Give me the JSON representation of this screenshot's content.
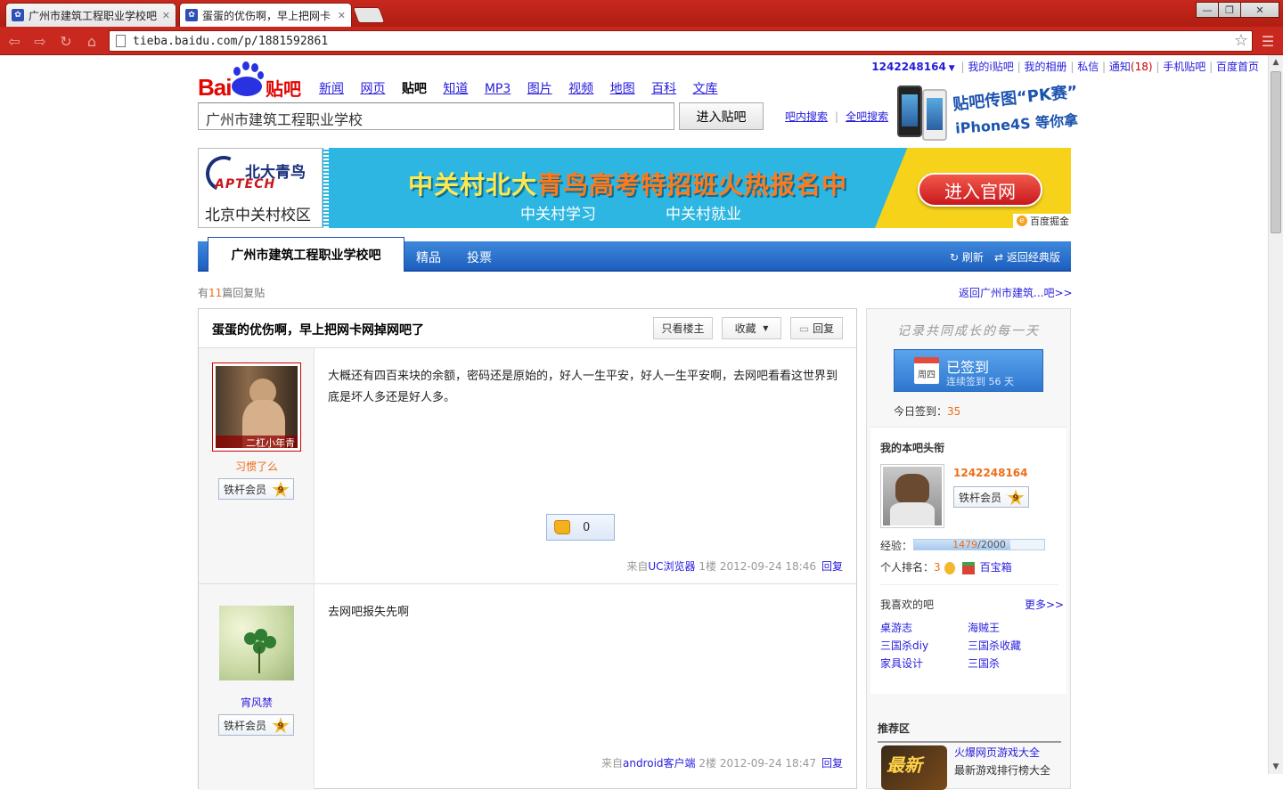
{
  "browser": {
    "tabs": [
      {
        "title": "广州市建筑工程职业学校吧"
      },
      {
        "title": "蛋蛋的优伤啊，早上把网卡"
      }
    ],
    "url": "tieba.baidu.com/p/1881592861"
  },
  "userbar": {
    "uid": "1242248164",
    "links": [
      "我的i贴吧",
      "我的相册",
      "私信"
    ],
    "notice_label": "通知",
    "notice_count": "(18)",
    "links2": [
      "手机贴吧",
      "百度首页"
    ]
  },
  "logo": {
    "bai": "Bai",
    "du": "du",
    "tieba": "贴吧"
  },
  "topnav": {
    "items": [
      "新闻",
      "网页",
      "贴吧",
      "知道",
      "MP3",
      "图片",
      "视频",
      "地图",
      "百科",
      "文库"
    ],
    "active": "贴吧"
  },
  "search": {
    "value": "广州市建筑工程职业学校",
    "button": "进入贴吧",
    "in_forum": "吧内搜索",
    "all_forum": "全吧搜索"
  },
  "promo": {
    "line1": "贴吧传图“PK赛”",
    "line2": "iPhone4S 等你拿"
  },
  "banner": {
    "brand_cn": "北大青鸟",
    "brand_en": "APTECH",
    "campus": "北京中关村校区",
    "headline_a": "中关村北大",
    "headline_b": "青鸟高考特招班火热报名中",
    "sub1": "中关村学习",
    "sub2": "中关村就业",
    "cta": "进入官网",
    "adtag": "百度掘金"
  },
  "forumbar": {
    "tab": "广州市建筑工程职业学校吧",
    "t2": "精品",
    "t3": "投票",
    "refresh": "刷新",
    "classic": "返回经典版"
  },
  "thread_info": {
    "prefix": "有",
    "count": "11",
    "suffix": "篇回复贴",
    "back": "返回广州市建筑...吧>>"
  },
  "thread": {
    "title": "蛋蛋的优伤啊，早上把网卡网掉网吧了",
    "only_author": "只看楼主",
    "favorite": "收藏",
    "reply": "回复"
  },
  "posts": [
    {
      "avatar_caption": "二杠小年青",
      "name": "习惯了么",
      "badge": "铁杆会员",
      "level": "9",
      "content": "大概还有四百来块的余额，密码还是原始的，好人一生平安，好人一生平安啊，去网吧看看这世界到底是坏人多还是好人多。",
      "likes": "0",
      "source_prefix": "来自",
      "source": "UC浏览器",
      "floor": "1楼",
      "time": "2012-09-24 18:46",
      "reply": "回复"
    },
    {
      "name": "宵风禁",
      "badge": "铁杆会员",
      "level": "9",
      "content": "去网吧报失先啊",
      "source_prefix": "来自",
      "source": "android客户端",
      "floor": "2楼",
      "time": "2012-09-24 18:47",
      "reply": "回复"
    }
  ],
  "sidebar": {
    "motto": "记录共同成长的每一天",
    "sign_status": "已签到",
    "sign_days": "连续签到 56 天",
    "weekday": "周四",
    "today_label": "今日签到：",
    "today_count": "35",
    "my_head_title": "我的本吧头衔",
    "my_name": "1242248164",
    "my_badge": "铁杆会员",
    "my_level": "9",
    "exp_label": "经验：",
    "exp_current": "1479",
    "exp_total": "/2000",
    "exp_fraction": 0.7395,
    "rank_label": "个人排名：",
    "rank_value": "3",
    "treasure": "百宝箱",
    "like_title": "我喜欢的吧",
    "more": "更多>>",
    "forums": [
      "桌游志",
      "海贼王",
      "三国杀diy",
      "三国杀收藏",
      "家具设计",
      "三国杀"
    ],
    "rec_title": "推荐区",
    "rec_img_text": "最新",
    "rec_link": "火爆网页游戏大全",
    "rec_desc": "最新游戏排行榜大全"
  }
}
